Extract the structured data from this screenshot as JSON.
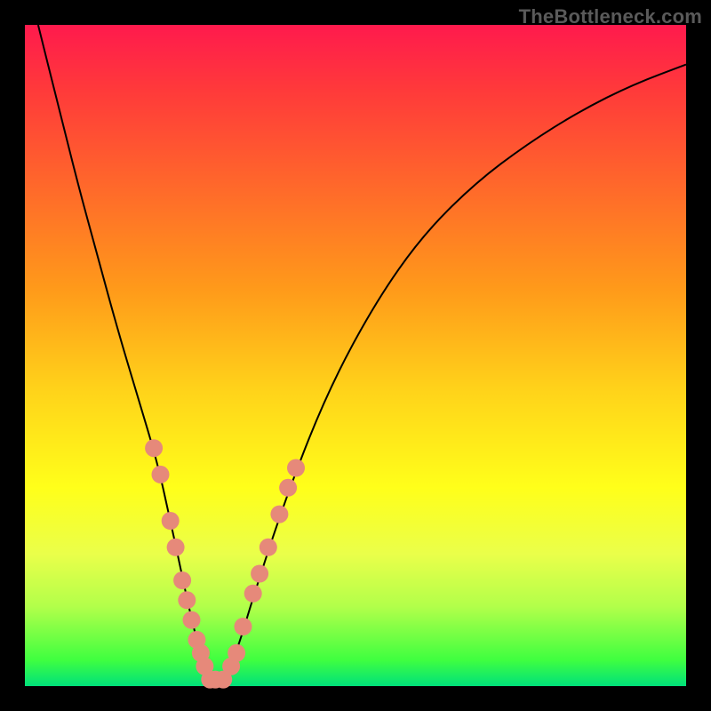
{
  "watermark": "TheBottleneck.com",
  "chart_data": {
    "type": "line",
    "title": "",
    "xlabel": "",
    "ylabel": "",
    "xlim": [
      0,
      100
    ],
    "ylim": [
      0,
      100
    ],
    "grid": false,
    "legend": false,
    "series": [
      {
        "name": "bottleneck-curve",
        "x": [
          2,
          5,
          8,
          11,
          14,
          17,
          20,
          22,
          23.5,
          25,
          26.5,
          28,
          30,
          32,
          35,
          40,
          46,
          53,
          60,
          68,
          76,
          84,
          92,
          100
        ],
        "y": [
          100,
          88,
          76,
          65,
          54,
          44,
          34,
          25,
          18,
          11,
          5,
          1,
          1,
          5,
          15,
          30,
          45,
          58,
          68,
          76,
          82,
          87,
          91,
          94
        ],
        "color": "#000000",
        "linewidth": 2
      }
    ],
    "scatter_points": {
      "name": "sample-dots",
      "color": "#e6897a",
      "radius": 10,
      "points": [
        {
          "x": 19.5,
          "y": 36
        },
        {
          "x": 20.5,
          "y": 32
        },
        {
          "x": 22.0,
          "y": 25
        },
        {
          "x": 22.8,
          "y": 21
        },
        {
          "x": 23.8,
          "y": 16
        },
        {
          "x": 24.5,
          "y": 13
        },
        {
          "x": 25.2,
          "y": 10
        },
        {
          "x": 26.0,
          "y": 7
        },
        {
          "x": 26.6,
          "y": 5
        },
        {
          "x": 27.2,
          "y": 3
        },
        {
          "x": 28.0,
          "y": 1
        },
        {
          "x": 28.8,
          "y": 1
        },
        {
          "x": 30.0,
          "y": 1
        },
        {
          "x": 31.2,
          "y": 3
        },
        {
          "x": 32.0,
          "y": 5
        },
        {
          "x": 33.0,
          "y": 9
        },
        {
          "x": 34.5,
          "y": 14
        },
        {
          "x": 35.5,
          "y": 17
        },
        {
          "x": 36.8,
          "y": 21
        },
        {
          "x": 38.5,
          "y": 26
        },
        {
          "x": 39.8,
          "y": 30
        },
        {
          "x": 41.0,
          "y": 33
        }
      ]
    }
  }
}
